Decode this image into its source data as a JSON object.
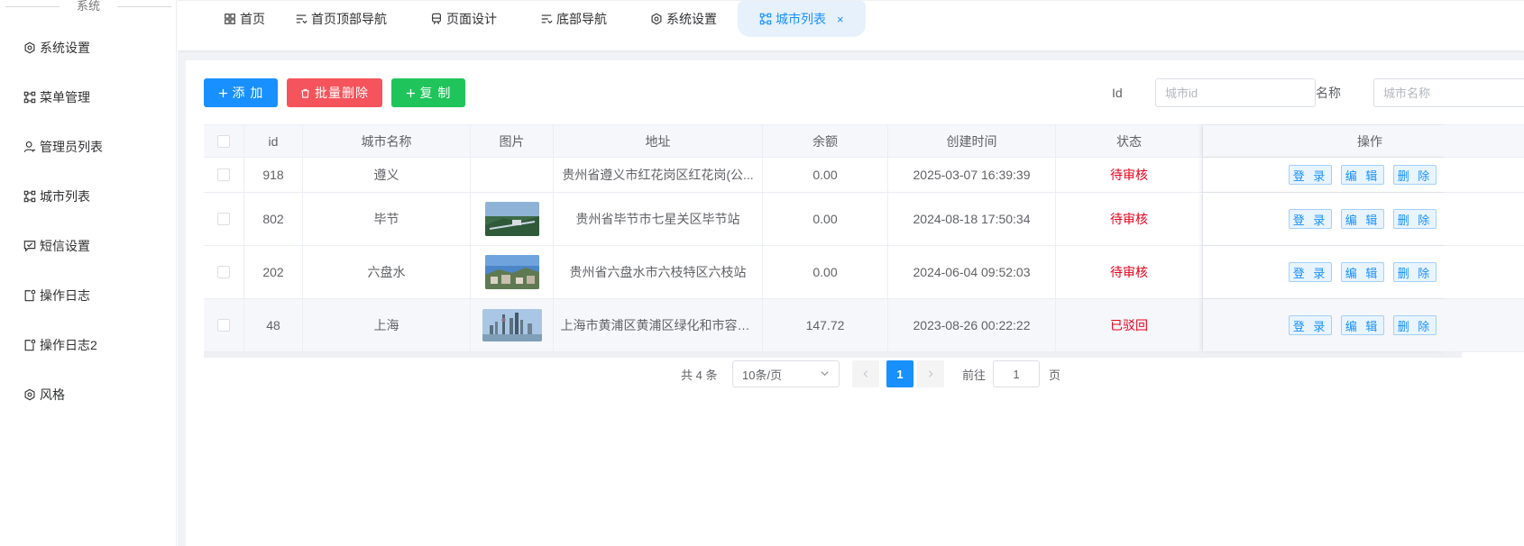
{
  "sidebar": {
    "section_title": "系统",
    "items": [
      {
        "label": "系统设置",
        "icon": "gear-hex-icon"
      },
      {
        "label": "菜单管理",
        "icon": "nodes-icon"
      },
      {
        "label": "管理员列表",
        "icon": "user-icon"
      },
      {
        "label": "城市列表",
        "icon": "nodes-icon"
      },
      {
        "label": "短信设置",
        "icon": "message-icon"
      },
      {
        "label": "操作日志",
        "icon": "document-icon"
      },
      {
        "label": "操作日志2",
        "icon": "document-icon"
      },
      {
        "label": "风格",
        "icon": "gear-hex-icon"
      }
    ]
  },
  "tabs": [
    {
      "label": "首页",
      "icon": "grid-icon"
    },
    {
      "label": "首页顶部导航",
      "icon": "list-nav-icon"
    },
    {
      "label": "页面设计",
      "icon": "train-icon"
    },
    {
      "label": "底部导航",
      "icon": "list-nav-icon"
    },
    {
      "label": "系统设置",
      "icon": "gear-hex-icon"
    },
    {
      "label": "城市列表",
      "icon": "nodes-icon",
      "active": true,
      "close": "×"
    }
  ],
  "toolbar": {
    "add_label": "添 加",
    "batch_delete_label": "批量删除",
    "copy_label": "复 制"
  },
  "search": {
    "id_label": "Id",
    "id_placeholder": "城市id",
    "name_label": "名称",
    "name_placeholder": "城市名称"
  },
  "table": {
    "headers": [
      "id",
      "城市名称",
      "图片",
      "地址",
      "余额",
      "创建时间",
      "状态",
      "操作"
    ],
    "rows": [
      {
        "id": "918",
        "name": "遵义",
        "image": "",
        "address": "贵州省遵义市红花岗区红花岗(公...",
        "balance": "0.00",
        "created": "2025-03-07 16:39:39",
        "status": "待审核"
      },
      {
        "id": "802",
        "name": "毕节",
        "image": "city-photo",
        "address": "贵州省毕节市七星关区毕节站",
        "balance": "0.00",
        "created": "2024-08-18 17:50:34",
        "status": "待审核"
      },
      {
        "id": "202",
        "name": "六盘水",
        "image": "city-photo",
        "address": "贵州省六盘水市六枝特区六枝站",
        "balance": "0.00",
        "created": "2024-06-04 09:52:03",
        "status": "待审核"
      },
      {
        "id": "48",
        "name": "上海",
        "image": "skyline-photo",
        "address": "上海市黄浦区黄浦区绿化和市容管...",
        "balance": "147.72",
        "created": "2023-08-26 00:22:22",
        "status": "已驳回"
      }
    ],
    "ops": {
      "login": "登 录",
      "edit": "编 辑",
      "delete": "删 除"
    }
  },
  "pagination": {
    "total": "共 4 条",
    "page_size": "10条/页",
    "current_page": "1",
    "goto_label": "前往",
    "goto_value": "1",
    "page_suffix": "页"
  },
  "colors": {
    "primary": "#1890ff",
    "danger": "#f5545c",
    "success": "#1fc45b",
    "status_red": "#e8001c"
  }
}
